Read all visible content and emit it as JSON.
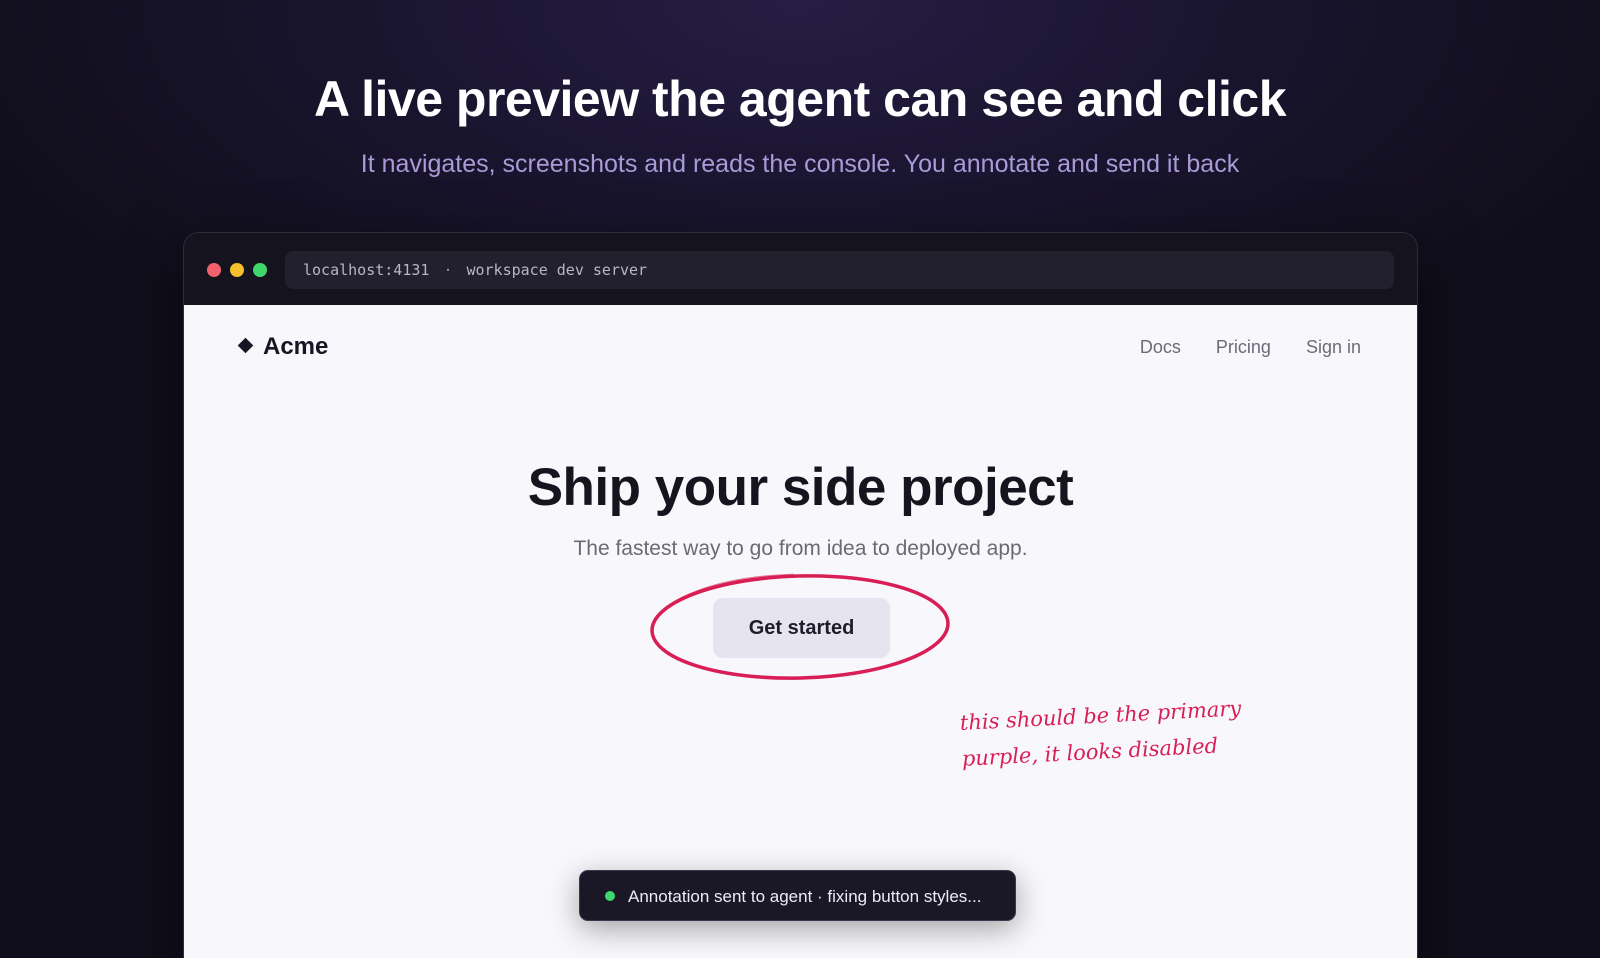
{
  "hero": {
    "title": "A live preview the agent can see and click",
    "subtitle": "It navigates, screenshots and reads the console. You annotate and send it back"
  },
  "browser": {
    "address": "localhost:4131",
    "separator": "·",
    "server_label": "workspace dev server",
    "traffic_lights": [
      "#f0626b",
      "#f5bf2d",
      "#3fd66c"
    ]
  },
  "site": {
    "logo_text": "Acme",
    "logo_icon": "diamond-icon",
    "nav": [
      "Docs",
      "Pricing",
      "Sign in"
    ],
    "heading": "Ship your side project",
    "tagline": "The fastest way to go from idea to deployed app.",
    "cta_label": "Get started"
  },
  "annotation": {
    "note_line1": "this should be the primary",
    "note_line2": "purple, it looks disabled",
    "color": "#d81e55"
  },
  "toast": {
    "message": "Annotation sent to agent · fixing button styles...",
    "status_color": "#3fd66c"
  }
}
